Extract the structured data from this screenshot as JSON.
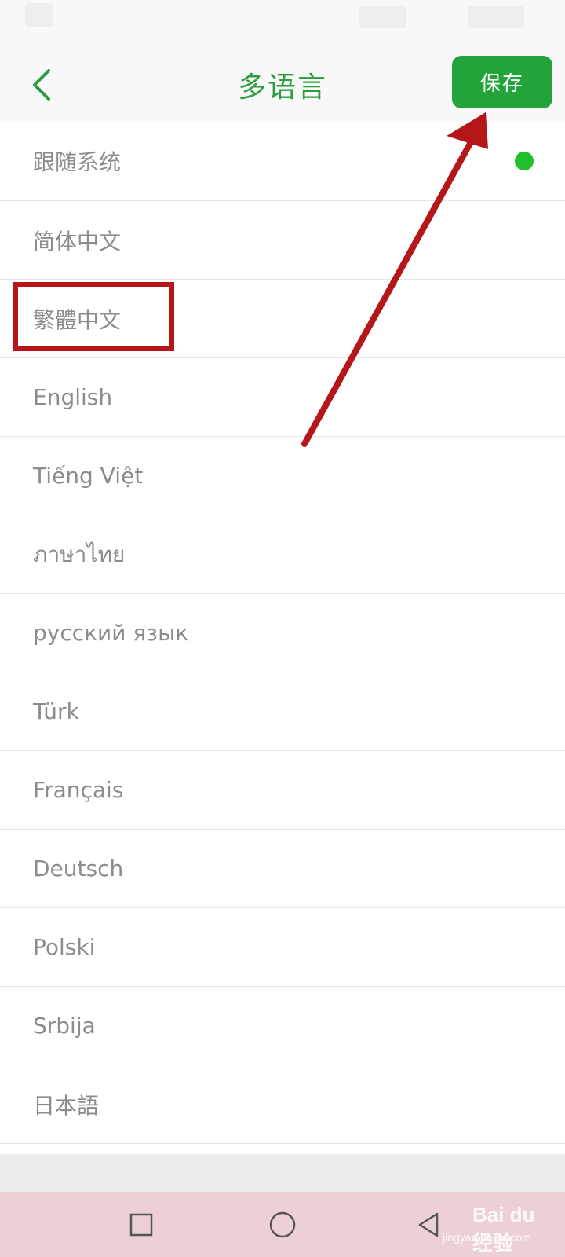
{
  "header": {
    "title": "多语言",
    "save_label": "保存",
    "back_icon": "chevron-left-icon",
    "accent_color": "#23a43a"
  },
  "languages": [
    {
      "label": "跟随系统",
      "selected": true
    },
    {
      "label": "简体中文",
      "selected": false
    },
    {
      "label": "繁體中文",
      "selected": false
    },
    {
      "label": "English",
      "selected": false
    },
    {
      "label": "Tiếng Việt",
      "selected": false
    },
    {
      "label": "ภาษาไทย",
      "selected": false
    },
    {
      "label": "русский язык",
      "selected": false
    },
    {
      "label": "Türk",
      "selected": false
    },
    {
      "label": "Français",
      "selected": false
    },
    {
      "label": "Deutsch",
      "selected": false
    },
    {
      "label": "Polski",
      "selected": false
    },
    {
      "label": "Srbija",
      "selected": false
    },
    {
      "label": "日本語",
      "selected": false
    }
  ],
  "selected_indicator_color": "#22c02a",
  "annotation": {
    "highlight_color": "#b5161a",
    "highlighted_item": "繁體中文"
  },
  "navigation_bar": {
    "buttons": [
      "recent-apps-icon",
      "home-icon",
      "back-triangle-icon"
    ]
  },
  "watermark": {
    "brand": "Bai du 经验",
    "url": "jingyan.baidu.com"
  }
}
